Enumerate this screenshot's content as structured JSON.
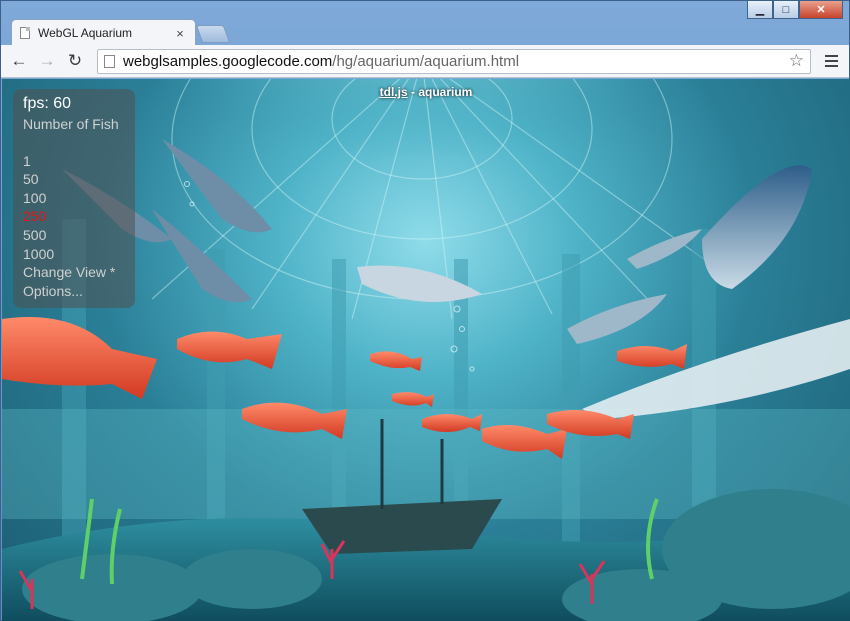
{
  "window": {
    "controls": [
      "minimize-icon",
      "maximize-icon",
      "close-icon"
    ]
  },
  "tab": {
    "title": "WebGL Aquarium",
    "close_glyph": "×"
  },
  "toolbar": {
    "back_glyph": "←",
    "forward_glyph": "→",
    "reload_glyph": "↻",
    "url_host": "webglsamples.googlecode.com",
    "url_path": "/hg/aquarium/aquarium.html",
    "star_glyph": "☆"
  },
  "page": {
    "header_link": "tdl.js",
    "header_rest": " - aquarium",
    "fps_label": "fps: 60",
    "number_of_fish_label": "Number of Fish",
    "fish_options": [
      "1",
      "50",
      "100",
      "250",
      "500",
      "1000"
    ],
    "selected_fish_option": "250",
    "change_view_label": "Change View *",
    "options_label": "Options..."
  },
  "colors": {
    "selected_option": "#e01818",
    "water_light": "#8fdcea",
    "water_dark": "#1a5b70"
  }
}
